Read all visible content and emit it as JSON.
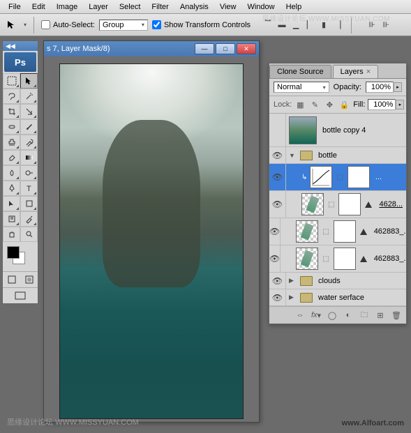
{
  "menu": {
    "items": [
      "File",
      "Edit",
      "Image",
      "Layer",
      "Select",
      "Filter",
      "Analysis",
      "View",
      "Window",
      "Help"
    ]
  },
  "options": {
    "auto_select_label": "Auto-Select:",
    "auto_select_checked": false,
    "group_value": "Group",
    "show_transform_label": "Show Transform Controls",
    "show_transform_checked": true
  },
  "document": {
    "title": "s 7, Layer Mask/8)"
  },
  "panels": {
    "tabs": [
      {
        "label": "Clone Source",
        "active": false
      },
      {
        "label": "Layers",
        "active": true
      }
    ],
    "blend_mode": "Normal",
    "opacity_label": "Opacity:",
    "opacity_value": "100%",
    "lock_label": "Lock:",
    "fill_label": "Fill:",
    "fill_value": "100%",
    "layers": [
      {
        "type": "layer",
        "visible": false,
        "indent": 0,
        "thumbs": [
          "image"
        ],
        "name": "bottle copy 4",
        "selected": false
      },
      {
        "type": "group",
        "visible": true,
        "indent": 0,
        "open": true,
        "name": "bottle",
        "selected": false
      },
      {
        "type": "adjustment",
        "visible": true,
        "indent": 1,
        "thumbs": [
          "curves",
          "mask"
        ],
        "name": "...",
        "selected": true
      },
      {
        "type": "layer",
        "visible": true,
        "indent": 1,
        "thumbs": [
          "trans",
          "mask"
        ],
        "name": "4628...",
        "selected": false,
        "underline": true,
        "shape": true
      },
      {
        "type": "layer",
        "visible": true,
        "indent": 1,
        "thumbs": [
          "trans",
          "mask"
        ],
        "name": "462883_...",
        "selected": false,
        "shape": true
      },
      {
        "type": "layer",
        "visible": true,
        "indent": 1,
        "thumbs": [
          "trans",
          "mask"
        ],
        "name": "462883_...",
        "selected": false,
        "shape": true
      },
      {
        "type": "group",
        "visible": true,
        "indent": 0,
        "open": false,
        "name": "clouds",
        "selected": false
      },
      {
        "type": "group",
        "visible": true,
        "indent": 0,
        "open": false,
        "name": "water serface",
        "selected": false
      }
    ]
  },
  "watermarks": {
    "top": "思缘设计论坛   WWW.MISSYUAN.COM",
    "bottom_left": "思缘设计论坛   WWW.MISSYUAN.COM",
    "bottom_right": "www.Alfoart.com"
  },
  "app": {
    "ps_label": "Ps"
  }
}
